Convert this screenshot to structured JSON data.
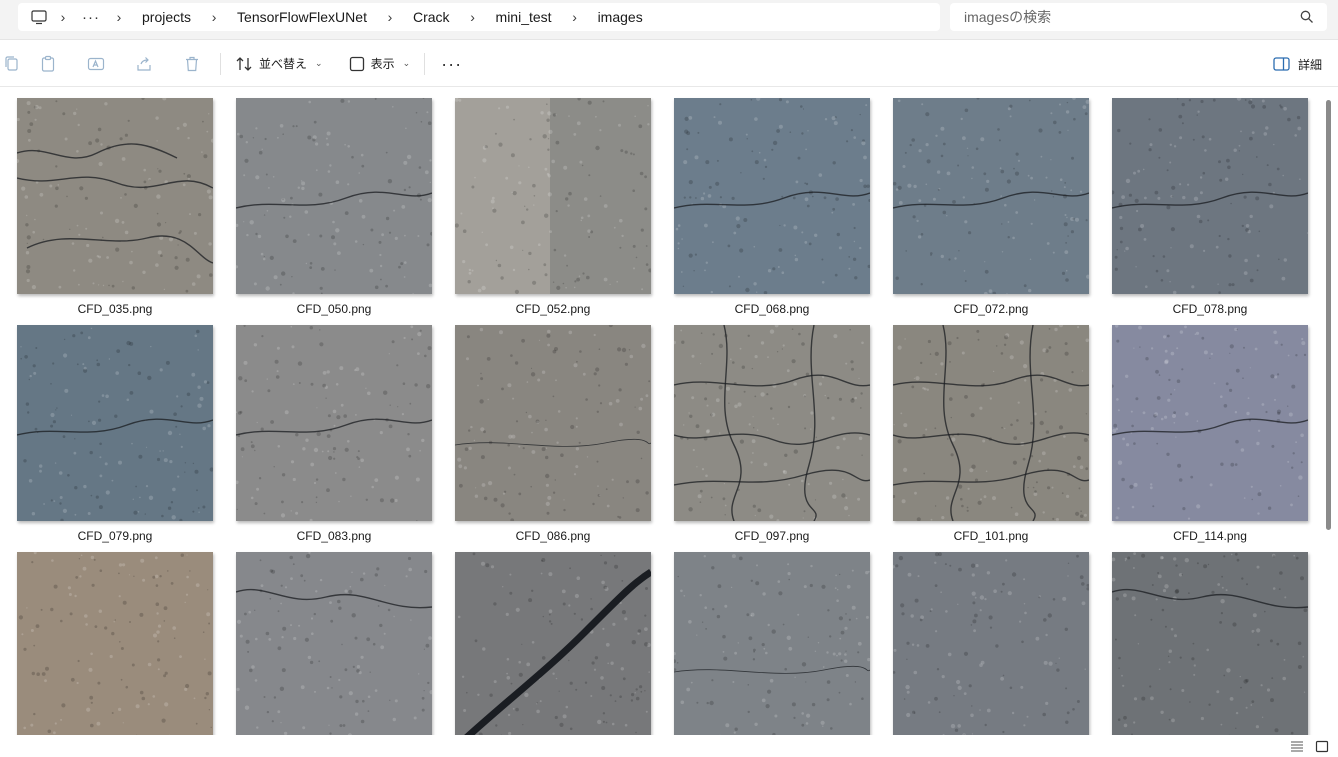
{
  "breadcrumb": {
    "overflow": "···",
    "items": [
      "projects",
      "TensorFlowFlexUNet",
      "Crack",
      "mini_test",
      "images"
    ]
  },
  "search": {
    "placeholder": "imagesの検索"
  },
  "toolbar": {
    "sort_label": "並べ替え",
    "view_label": "表示",
    "more": "···",
    "details_label": "詳細"
  },
  "files": [
    {
      "name": "CFD_035.png",
      "tone": "#8e8a82",
      "crack": "heavy"
    },
    {
      "name": "CFD_050.png",
      "tone": "#86898c",
      "crack": "light"
    },
    {
      "name": "CFD_052.png",
      "tone": "#8c8c88",
      "crack": "split"
    },
    {
      "name": "CFD_068.png",
      "tone": "#6c7d8c",
      "crack": "light"
    },
    {
      "name": "CFD_072.png",
      "tone": "#6e7d8a",
      "crack": "light"
    },
    {
      "name": "CFD_078.png",
      "tone": "#6d7680",
      "crack": "light"
    },
    {
      "name": "CFD_079.png",
      "tone": "#657785",
      "crack": "light"
    },
    {
      "name": "CFD_083.png",
      "tone": "#8b8b8b",
      "crack": "light"
    },
    {
      "name": "CFD_086.png",
      "tone": "#898680",
      "crack": "faint"
    },
    {
      "name": "CFD_097.png",
      "tone": "#8d8b85",
      "crack": "web"
    },
    {
      "name": "CFD_101.png",
      "tone": "#8a877f",
      "crack": "web"
    },
    {
      "name": "CFD_114.png",
      "tone": "#868aa0",
      "crack": "light"
    },
    {
      "name": "",
      "tone": "#9a8c7c",
      "crack": "none"
    },
    {
      "name": "",
      "tone": "#86888c",
      "crack": "dark"
    },
    {
      "name": "",
      "tone": "#77787a",
      "crack": "wide"
    },
    {
      "name": "",
      "tone": "#7e8388",
      "crack": "faint"
    },
    {
      "name": "",
      "tone": "#767b82",
      "crack": "none"
    },
    {
      "name": "",
      "tone": "#6e7276",
      "crack": "dark"
    }
  ]
}
